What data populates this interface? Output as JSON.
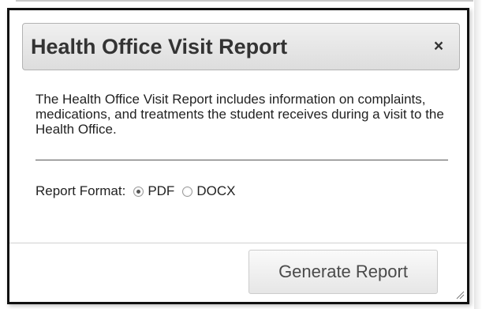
{
  "dialog": {
    "title": "Health Office Visit Report",
    "close_glyph": "×",
    "close_icon": "close-icon",
    "description": "The Health Office Visit Report includes information on complaints, medications, and treatments the student receives during a visit to the Health Office.",
    "format_label": "Report Format:",
    "formats": [
      {
        "label": "PDF",
        "selected": true
      },
      {
        "label": "DOCX",
        "selected": false
      }
    ],
    "generate_label": "Generate Report",
    "resize_icon": "resize-grip-icon"
  }
}
